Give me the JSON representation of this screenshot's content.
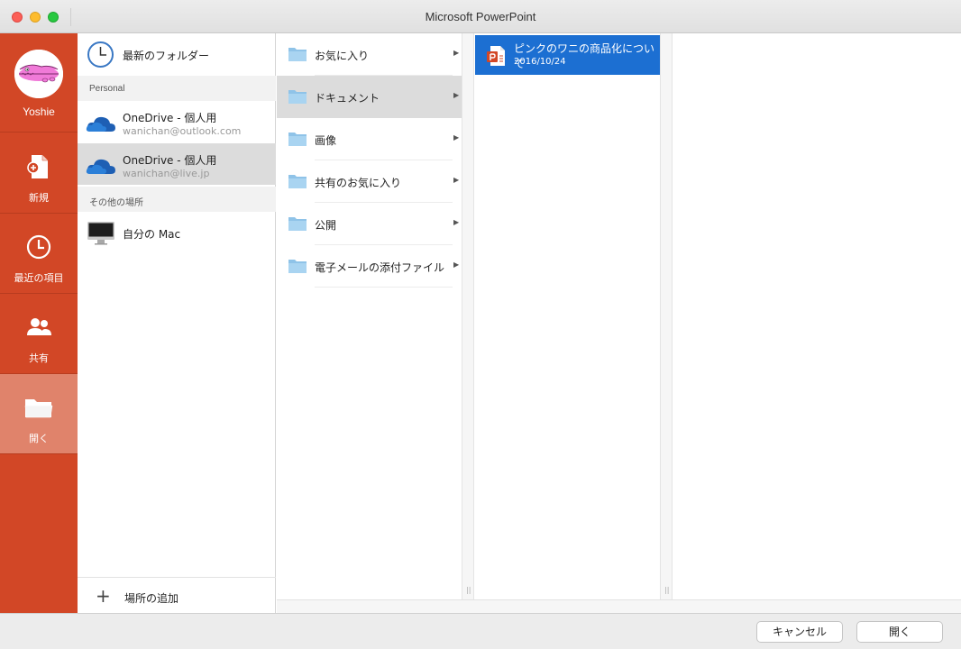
{
  "window": {
    "title": "Microsoft PowerPoint"
  },
  "sidebar": {
    "user_name": "Yoshie",
    "items": [
      {
        "label": "新規",
        "icon": "new-document-icon"
      },
      {
        "label": "最近の項目",
        "icon": "clock-icon"
      },
      {
        "label": "共有",
        "icon": "people-icon"
      },
      {
        "label": "開く",
        "icon": "open-folder-icon",
        "active": true
      }
    ]
  },
  "locations": {
    "recent_folders": "最新のフォルダー",
    "personal_header": "Personal",
    "personal": [
      {
        "title": "OneDrive - 個人用",
        "account": "wanichan@outlook.com"
      },
      {
        "title": "OneDrive - 個人用",
        "account": "wanichan@live.jp",
        "selected": true
      }
    ],
    "other_header": "その他の場所",
    "my_mac": "自分の Mac",
    "add_place": "場所の追加"
  },
  "folders": [
    {
      "label": "お気に入り"
    },
    {
      "label": "ドキュメント",
      "selected": true
    },
    {
      "label": "画像"
    },
    {
      "label": "共有のお気に入り"
    },
    {
      "label": "公開"
    },
    {
      "label": "電子メールの添付ファイル"
    }
  ],
  "files": [
    {
      "name": "ピンクのワニの商品化について",
      "date": "2016/10/24",
      "icon": "powerpoint-file-icon"
    }
  ],
  "buttons": {
    "cancel": "キャンセル",
    "open": "開く"
  },
  "colors": {
    "accent": "#d24726",
    "selection": "#1c6fd2"
  }
}
